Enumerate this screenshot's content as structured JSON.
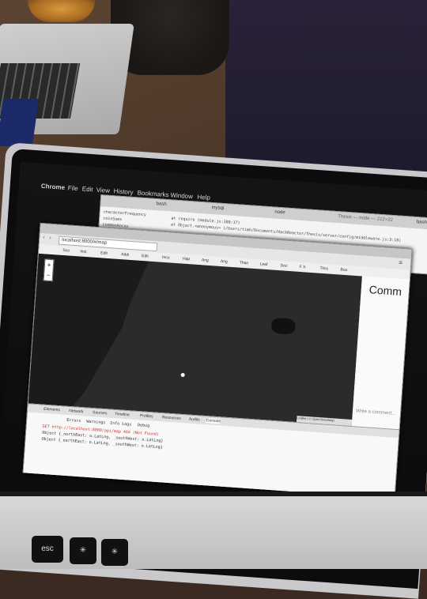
{
  "menubar": {
    "app": "Chrome",
    "items": [
      "File",
      "Edit",
      "View",
      "History",
      "Bookmarks",
      "Window",
      "Help"
    ]
  },
  "terminal": {
    "tabs": [
      "bash",
      "mysql",
      "node",
      "bash"
    ],
    "title": "Thesis — node — 212×32",
    "lines": [
      "at require (module.js:380:17)",
      "at Object.<anonymous> (/Users/timh/Documents/HackReactor/Thesis/server/config/middleware.js:3:18)"
    ]
  },
  "finder_items": [
    "characterFrequency",
    "coinSums",
    "commonAnces",
    "commonChara",
    "deepEquality"
  ],
  "browser": {
    "url": "localhost:8000/#/map",
    "bookmarks": [
      "Sco",
      "Inst",
      "Edit",
      "Addi",
      "Edit",
      "Incu",
      "Hap",
      "Ang",
      "Ang",
      "Than",
      "Leaf",
      "Doc",
      "F X",
      "Timc",
      "Boo"
    ],
    "sidebar_title": "Comm",
    "comment_placeholder": "Write a comment...",
    "attribution": "Leaflet | © OpenStreetMap",
    "zoom_in": "+",
    "zoom_out": "−"
  },
  "devtools": {
    "tabs": [
      "Elements",
      "Network",
      "Sources",
      "Timeline",
      "Profiles",
      "Resources",
      "Audits",
      "Console"
    ],
    "filters": [
      "Errors",
      "Warnings",
      "Info",
      "Logs",
      "Debug"
    ],
    "lines": [
      "GET http://localhost:8000/api/map 404 (Not Found)",
      "Object {_northEast: o.LatLng, _southWest: o.LatLng}",
      "Object {_northEast: o.LatLng, _southWest: o.LatLng}"
    ]
  },
  "keys": {
    "esc": "esc"
  }
}
